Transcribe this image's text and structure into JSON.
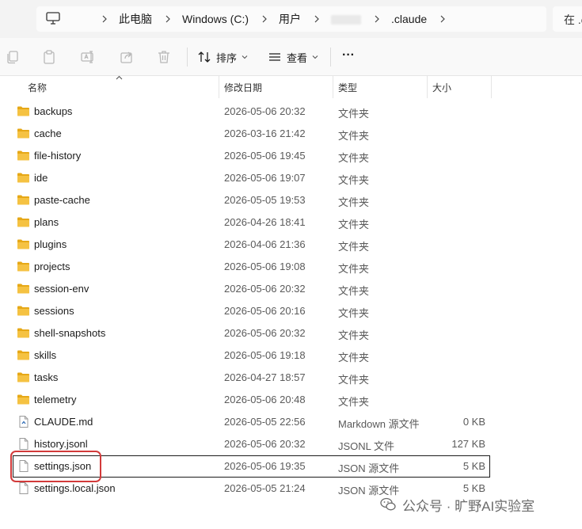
{
  "address_bar": {
    "crumbs": [
      "此电脑",
      "Windows (C:)",
      "用户",
      ".claude"
    ],
    "search_placeholder": "在 .c"
  },
  "toolbar": {
    "sort_label": "排序",
    "view_label": "查看",
    "more_label": "···"
  },
  "columns": {
    "name": "名称",
    "date": "修改日期",
    "type": "类型",
    "size": "大小"
  },
  "files": [
    {
      "name": "backups",
      "date": "2026-05-06 20:32",
      "type": "文件夹",
      "size": "",
      "kind": "folder"
    },
    {
      "name": "cache",
      "date": "2026-03-16 21:42",
      "type": "文件夹",
      "size": "",
      "kind": "folder"
    },
    {
      "name": "file-history",
      "date": "2026-05-06 19:45",
      "type": "文件夹",
      "size": "",
      "kind": "folder"
    },
    {
      "name": "ide",
      "date": "2026-05-06 19:07",
      "type": "文件夹",
      "size": "",
      "kind": "folder"
    },
    {
      "name": "paste-cache",
      "date": "2026-05-05 19:53",
      "type": "文件夹",
      "size": "",
      "kind": "folder"
    },
    {
      "name": "plans",
      "date": "2026-04-26 18:41",
      "type": "文件夹",
      "size": "",
      "kind": "folder"
    },
    {
      "name": "plugins",
      "date": "2026-04-06 21:36",
      "type": "文件夹",
      "size": "",
      "kind": "folder"
    },
    {
      "name": "projects",
      "date": "2026-05-06 19:08",
      "type": "文件夹",
      "size": "",
      "kind": "folder"
    },
    {
      "name": "session-env",
      "date": "2026-05-06 20:32",
      "type": "文件夹",
      "size": "",
      "kind": "folder"
    },
    {
      "name": "sessions",
      "date": "2026-05-06 20:16",
      "type": "文件夹",
      "size": "",
      "kind": "folder"
    },
    {
      "name": "shell-snapshots",
      "date": "2026-05-06 20:32",
      "type": "文件夹",
      "size": "",
      "kind": "folder"
    },
    {
      "name": "skills",
      "date": "2026-05-06 19:18",
      "type": "文件夹",
      "size": "",
      "kind": "folder"
    },
    {
      "name": "tasks",
      "date": "2026-04-27 18:57",
      "type": "文件夹",
      "size": "",
      "kind": "folder"
    },
    {
      "name": "telemetry",
      "date": "2026-05-06 20:48",
      "type": "文件夹",
      "size": "",
      "kind": "folder"
    },
    {
      "name": "CLAUDE.md",
      "date": "2026-05-05 22:56",
      "type": "Markdown 源文件",
      "size": "0 KB",
      "kind": "markdown"
    },
    {
      "name": "history.jsonl",
      "date": "2026-05-06 20:32",
      "type": "JSONL 文件",
      "size": "127 KB",
      "kind": "file"
    },
    {
      "name": "settings.json",
      "date": "2026-05-06 19:35",
      "type": "JSON 源文件",
      "size": "5 KB",
      "kind": "file",
      "selected": true
    },
    {
      "name": "settings.local.json",
      "date": "2026-05-05 21:24",
      "type": "JSON 源文件",
      "size": "5 KB",
      "kind": "file"
    }
  ],
  "watermark": {
    "text": "公众号 · 旷野AI实验室"
  },
  "colors": {
    "folder": "#f5c242",
    "folder_dark": "#e6a817",
    "highlight": "#d23a3a"
  }
}
